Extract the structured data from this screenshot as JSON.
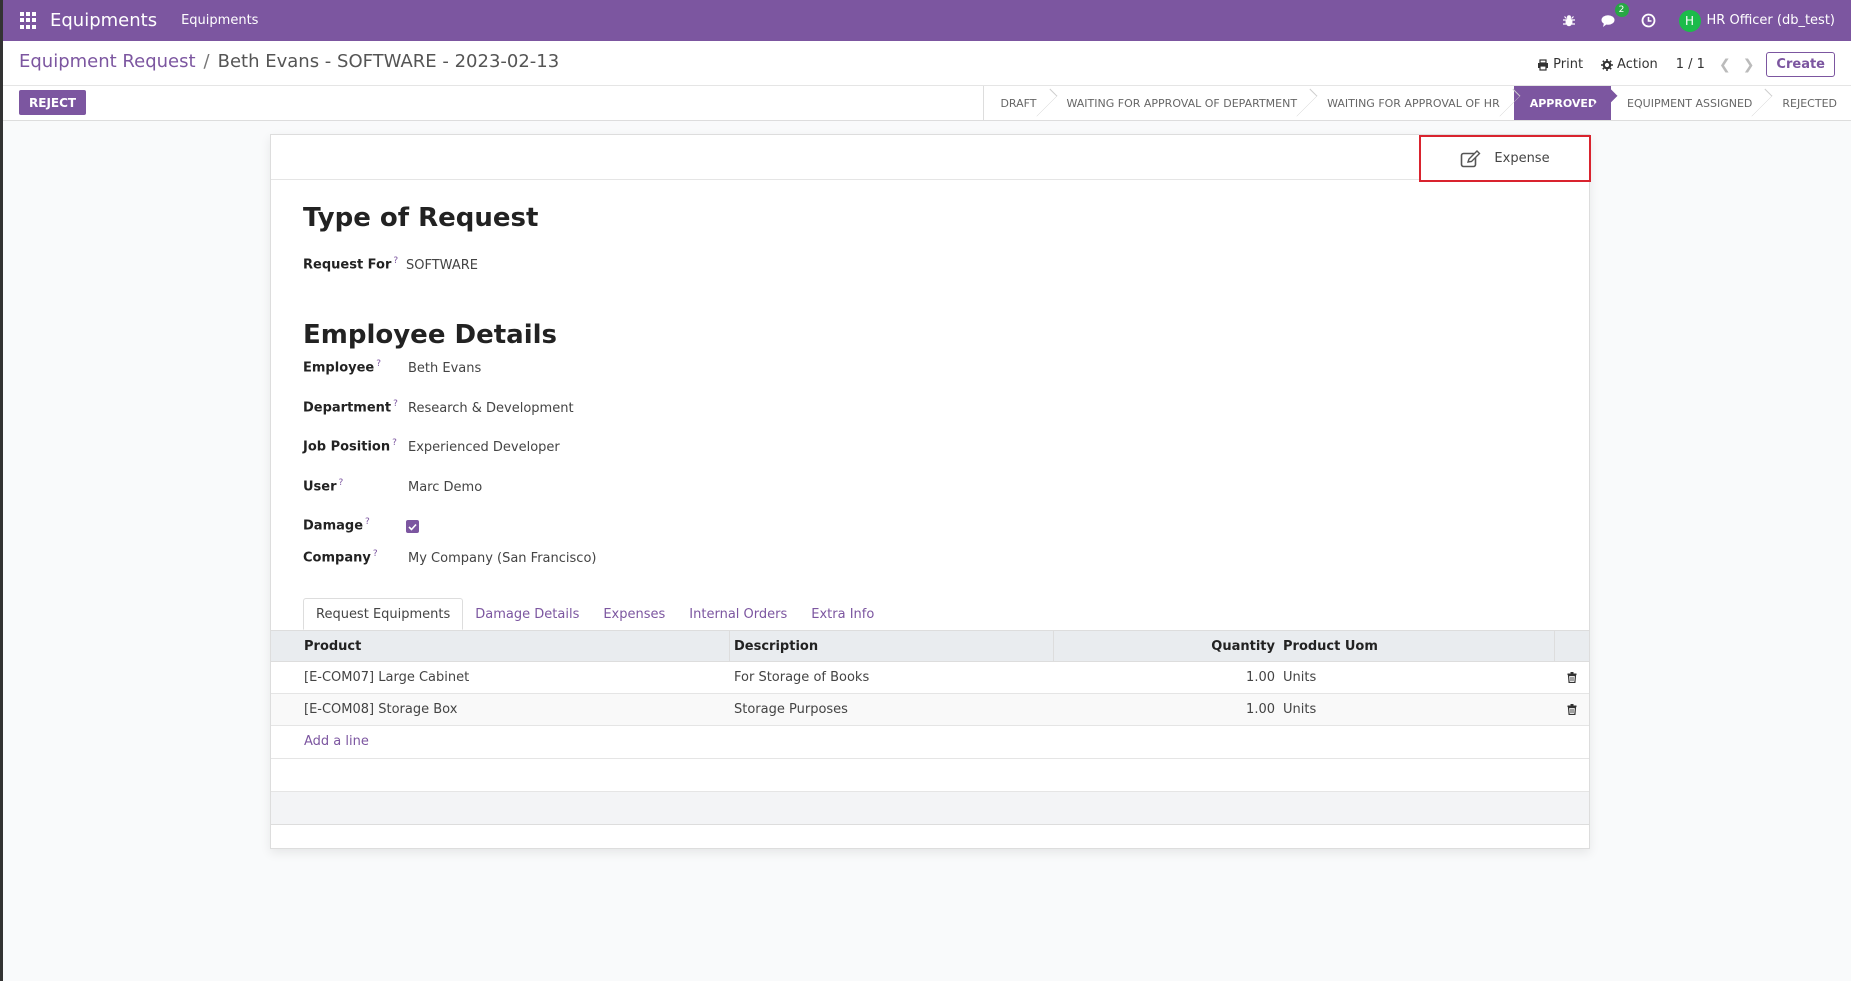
{
  "navbar": {
    "app_name": "Equipments",
    "menu_item": "Equipments",
    "messages_badge": "2",
    "user_initial": "H",
    "user_name": "HR Officer (db_test)"
  },
  "breadcrumb": {
    "parent": "Equipment Request",
    "separator": "/",
    "current": "Beth Evans - SOFTWARE - 2023-02-13"
  },
  "control": {
    "print_label": "Print",
    "action_label": "Action",
    "pager": "1 / 1",
    "create_label": "Create"
  },
  "status": {
    "reject_label": "REJECT",
    "stages": [
      {
        "label": "DRAFT",
        "active": false
      },
      {
        "label": "WAITING FOR APPROVAL OF DEPARTMENT",
        "active": false
      },
      {
        "label": "WAITING FOR APPROVAL OF HR",
        "active": false
      },
      {
        "label": "APPROVED",
        "active": true
      },
      {
        "label": "EQUIPMENT ASSIGNED",
        "active": false
      },
      {
        "label": "REJECTED",
        "active": false
      }
    ]
  },
  "smart_button": {
    "label": "Expense"
  },
  "form": {
    "type_title": "Type of Request",
    "request_for_label": "Request For",
    "request_for_value": "SOFTWARE",
    "employee_title": "Employee Details",
    "employee_label": "Employee",
    "employee_value": "Beth Evans",
    "department_label": "Department",
    "department_value": "Research & Development",
    "job_label": "Job Position",
    "job_value": "Experienced Developer",
    "user_label": "User",
    "user_value": "Marc Demo",
    "damage_label": "Damage",
    "damage_checked": true,
    "company_label": "Company",
    "company_value": "My Company (San Francisco)",
    "help_mark": "?"
  },
  "tabs": [
    "Request Equipments",
    "Damage Details",
    "Expenses",
    "Internal Orders",
    "Extra Info"
  ],
  "table": {
    "headers": {
      "product": "Product",
      "description": "Description",
      "quantity": "Quantity",
      "uom": "Product Uom"
    },
    "rows": [
      {
        "product": "[E-COM07] Large Cabinet",
        "description": "For Storage of Books",
        "quantity": "1.00",
        "uom": "Units"
      },
      {
        "product": "[E-COM08] Storage Box",
        "description": "Storage Purposes",
        "quantity": "1.00",
        "uom": "Units"
      }
    ],
    "add_line": "Add a line"
  },
  "colors": {
    "brand": "#7c56a0",
    "highlight": "#d9232e",
    "avatar": "#1cbb4a"
  }
}
